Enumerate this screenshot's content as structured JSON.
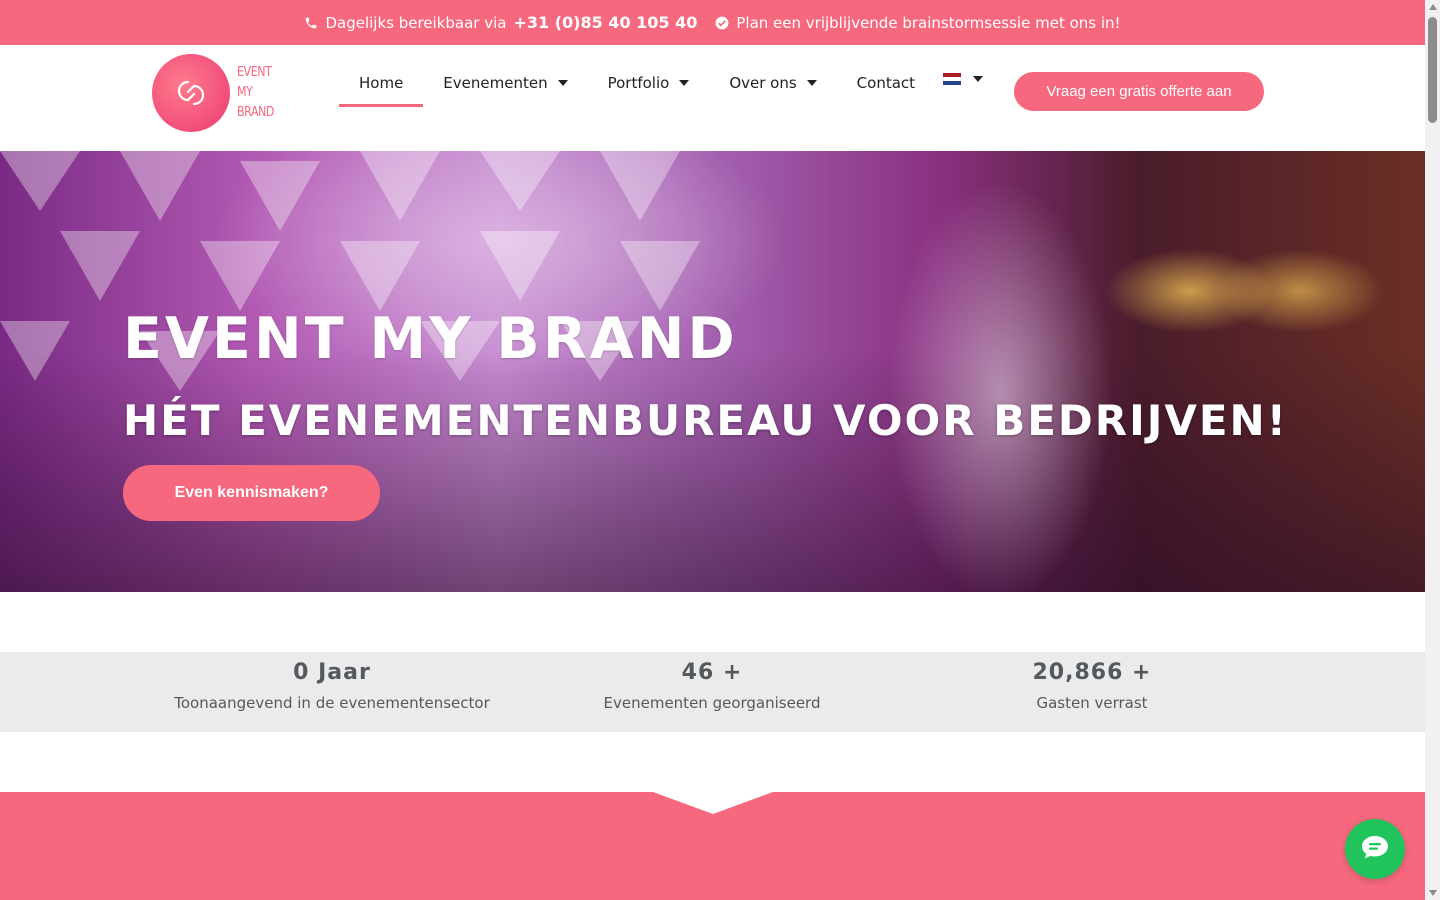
{
  "colors": {
    "brand_pink": "#f6687d",
    "chat_green": "#20c35c",
    "stats_bg": "#ebebeb",
    "stats_text": "#54595f"
  },
  "topbar": {
    "phone_icon": "phone-icon",
    "phone_prefix": "Dagelijks bereikbaar via",
    "phone_number": "+31 (0)85 40 105 40",
    "check_icon": "check-circle-icon",
    "brainstorm_text": "Plan een vrijblijvende brainstormsessie met ons in!"
  },
  "logo": {
    "line1": "EVENT",
    "line2": "MY",
    "line3": "BRAND"
  },
  "nav": {
    "items": [
      {
        "label": "Home",
        "active": true,
        "dropdown": false
      },
      {
        "label": "Evenementen",
        "active": false,
        "dropdown": true
      },
      {
        "label": "Portfolio",
        "active": false,
        "dropdown": true
      },
      {
        "label": "Over ons",
        "active": false,
        "dropdown": true
      },
      {
        "label": "Contact",
        "active": false,
        "dropdown": false
      }
    ],
    "language_flag": "netherlands-flag-icon"
  },
  "header": {
    "cta_label": "Vraag een gratis offerte aan"
  },
  "hero": {
    "title": "EVENT MY BRAND",
    "subtitle": "HÉT EVENEMENTENBUREAU VOOR BEDRIJVEN!",
    "button_label": "Even kennismaken?"
  },
  "stats": [
    {
      "number": "0 Jaar",
      "label": "Toonaangevend in de evenementensector"
    },
    {
      "number": "46 +",
      "label": "Evenementen georganiseerd"
    },
    {
      "number": "20,866 +",
      "label": "Gasten verrast"
    }
  ],
  "chat": {
    "icon": "chat-bubble-icon"
  }
}
